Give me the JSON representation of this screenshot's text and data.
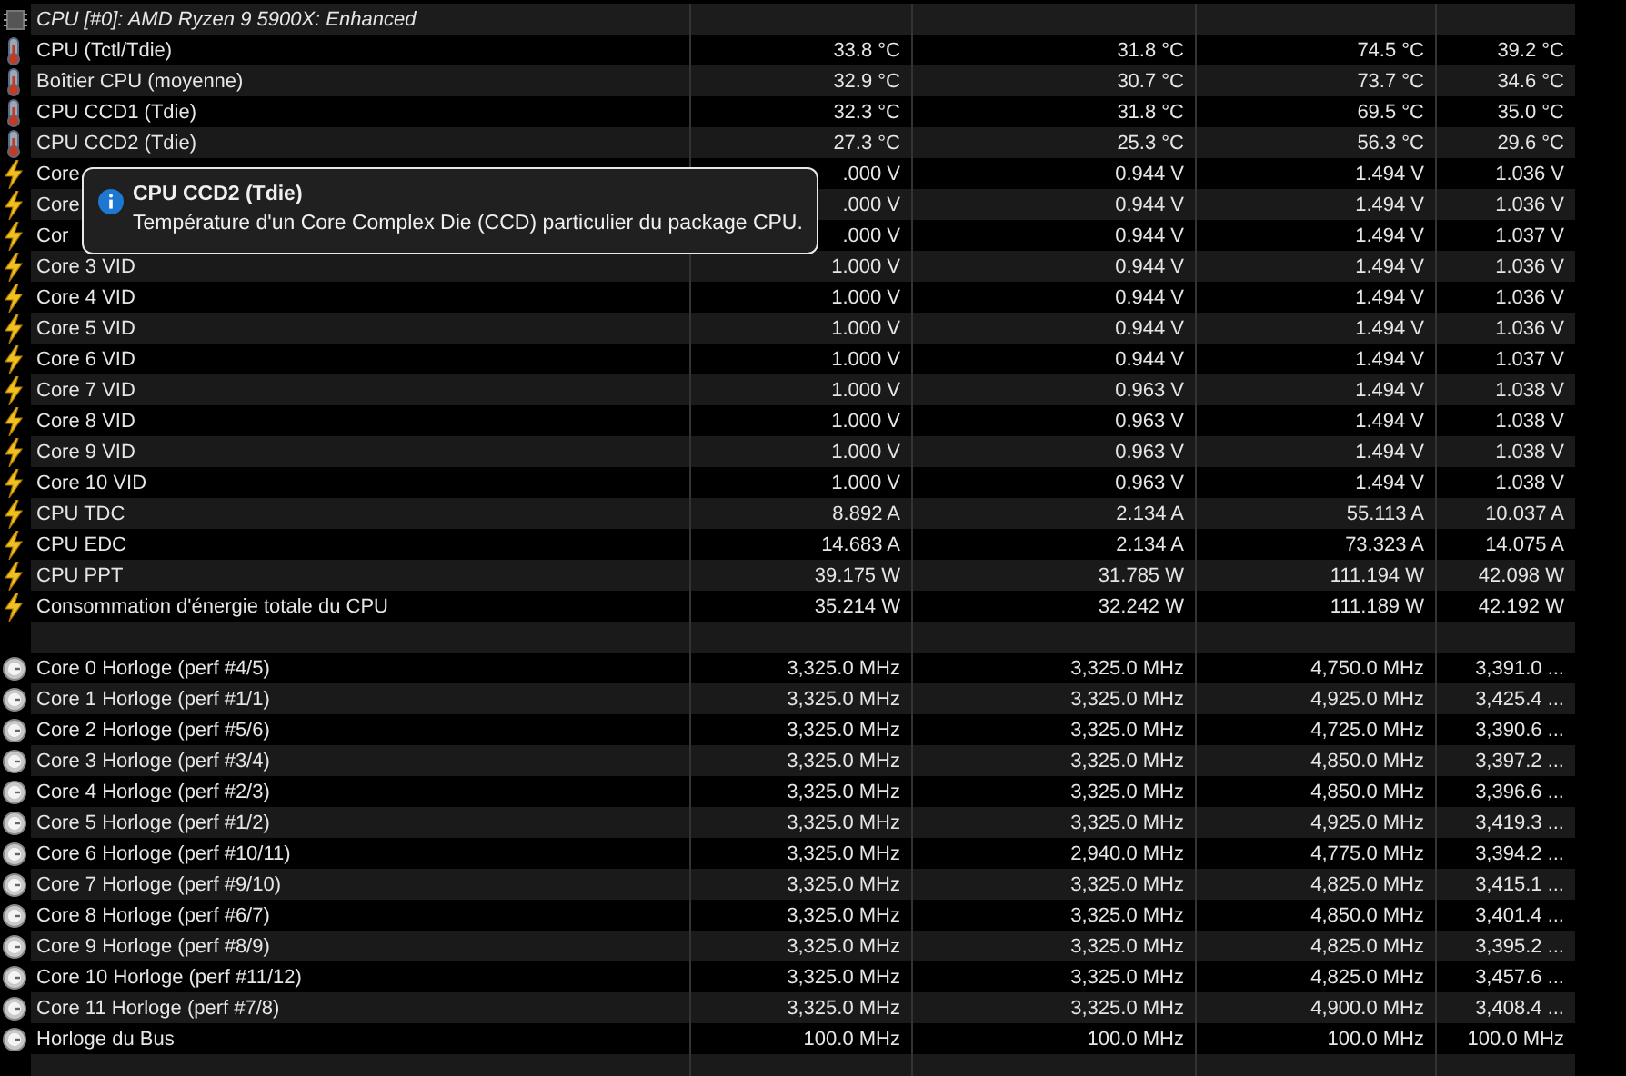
{
  "sensor_group": {
    "title": "CPU [#0]: AMD Ryzen 9 5900X: Enhanced",
    "rows": [
      {
        "kind": "temperature",
        "label": "CPU (Tctl/Tdie)",
        "values": [
          "33.8 °C",
          "31.8 °C",
          "74.5 °C",
          "39.2 °C"
        ]
      },
      {
        "kind": "temperature",
        "label": "Boîtier CPU (moyenne)",
        "values": [
          "32.9 °C",
          "30.7 °C",
          "73.7 °C",
          "34.6 °C"
        ]
      },
      {
        "kind": "temperature",
        "label": "CPU CCD1 (Tdie)",
        "values": [
          "32.3 °C",
          "31.8 °C",
          "69.5 °C",
          "35.0 °C"
        ]
      },
      {
        "kind": "temperature",
        "label": "CPU CCD2 (Tdie)",
        "values": [
          "27.3 °C",
          "25.3 °C",
          "56.3 °C",
          "29.6 °C"
        ]
      },
      {
        "kind": "voltage",
        "label": "Core",
        "values": [
          ".000 V",
          "0.944 V",
          "1.494 V",
          "1.036 V"
        ]
      },
      {
        "kind": "voltage",
        "label": "Core",
        "values": [
          ".000 V",
          "0.944 V",
          "1.494 V",
          "1.036 V"
        ]
      },
      {
        "kind": "voltage",
        "label": "Cor",
        "values": [
          ".000 V",
          "0.944 V",
          "1.494 V",
          "1.037 V"
        ]
      },
      {
        "kind": "voltage",
        "label": "Core 3 VID",
        "values": [
          "1.000 V",
          "0.944 V",
          "1.494 V",
          "1.036 V"
        ]
      },
      {
        "kind": "voltage",
        "label": "Core 4 VID",
        "values": [
          "1.000 V",
          "0.944 V",
          "1.494 V",
          "1.036 V"
        ]
      },
      {
        "kind": "voltage",
        "label": "Core 5 VID",
        "values": [
          "1.000 V",
          "0.944 V",
          "1.494 V",
          "1.036 V"
        ]
      },
      {
        "kind": "voltage",
        "label": "Core 6 VID",
        "values": [
          "1.000 V",
          "0.944 V",
          "1.494 V",
          "1.037 V"
        ]
      },
      {
        "kind": "voltage",
        "label": "Core 7 VID",
        "values": [
          "1.000 V",
          "0.963 V",
          "1.494 V",
          "1.038 V"
        ]
      },
      {
        "kind": "voltage",
        "label": "Core 8 VID",
        "values": [
          "1.000 V",
          "0.963 V",
          "1.494 V",
          "1.038 V"
        ]
      },
      {
        "kind": "voltage",
        "label": "Core 9 VID",
        "values": [
          "1.000 V",
          "0.963 V",
          "1.494 V",
          "1.038 V"
        ]
      },
      {
        "kind": "voltage",
        "label": "Core 10 VID",
        "values": [
          "1.000 V",
          "0.963 V",
          "1.494 V",
          "1.038 V"
        ]
      },
      {
        "kind": "voltage",
        "label": "CPU TDC",
        "values": [
          "8.892 A",
          "2.134 A",
          "55.113 A",
          "10.037 A"
        ]
      },
      {
        "kind": "voltage",
        "label": "CPU EDC",
        "values": [
          "14.683 A",
          "2.134 A",
          "73.323 A",
          "14.075 A"
        ]
      },
      {
        "kind": "voltage",
        "label": "CPU PPT",
        "values": [
          "39.175 W",
          "31.785 W",
          "111.194 W",
          "42.098 W"
        ]
      },
      {
        "kind": "voltage",
        "label": "Consommation d'énergie totale du CPU",
        "values": [
          "35.214 W",
          "32.242 W",
          "111.189 W",
          "42.192 W"
        ]
      },
      {
        "kind": "spacer"
      },
      {
        "kind": "clock",
        "label": "Core 0 Horloge (perf #4/5)",
        "values": [
          "3,325.0 MHz",
          "3,325.0 MHz",
          "4,750.0 MHz",
          "3,391.0 ..."
        ]
      },
      {
        "kind": "clock",
        "label": "Core 1 Horloge (perf #1/1)",
        "values": [
          "3,325.0 MHz",
          "3,325.0 MHz",
          "4,925.0 MHz",
          "3,425.4 ..."
        ]
      },
      {
        "kind": "clock",
        "label": "Core 2 Horloge (perf #5/6)",
        "values": [
          "3,325.0 MHz",
          "3,325.0 MHz",
          "4,725.0 MHz",
          "3,390.6 ..."
        ]
      },
      {
        "kind": "clock",
        "label": "Core 3 Horloge (perf #3/4)",
        "values": [
          "3,325.0 MHz",
          "3,325.0 MHz",
          "4,850.0 MHz",
          "3,397.2 ..."
        ]
      },
      {
        "kind": "clock",
        "label": "Core 4 Horloge (perf #2/3)",
        "values": [
          "3,325.0 MHz",
          "3,325.0 MHz",
          "4,850.0 MHz",
          "3,396.6 ..."
        ]
      },
      {
        "kind": "clock",
        "label": "Core 5 Horloge (perf #1/2)",
        "values": [
          "3,325.0 MHz",
          "3,325.0 MHz",
          "4,925.0 MHz",
          "3,419.3 ..."
        ]
      },
      {
        "kind": "clock",
        "label": "Core 6 Horloge (perf #10/11)",
        "values": [
          "3,325.0 MHz",
          "2,940.0 MHz",
          "4,775.0 MHz",
          "3,394.2 ..."
        ]
      },
      {
        "kind": "clock",
        "label": "Core 7 Horloge (perf #9/10)",
        "values": [
          "3,325.0 MHz",
          "3,325.0 MHz",
          "4,825.0 MHz",
          "3,415.1 ..."
        ]
      },
      {
        "kind": "clock",
        "label": "Core 8 Horloge (perf #6/7)",
        "values": [
          "3,325.0 MHz",
          "3,325.0 MHz",
          "4,850.0 MHz",
          "3,401.4 ..."
        ]
      },
      {
        "kind": "clock",
        "label": "Core 9 Horloge (perf #8/9)",
        "values": [
          "3,325.0 MHz",
          "3,325.0 MHz",
          "4,825.0 MHz",
          "3,395.2 ..."
        ]
      },
      {
        "kind": "clock",
        "label": "Core 10 Horloge (perf #11/12)",
        "values": [
          "3,325.0 MHz",
          "3,325.0 MHz",
          "4,825.0 MHz",
          "3,457.6 ..."
        ]
      },
      {
        "kind": "clock",
        "label": "Core 11 Horloge (perf #7/8)",
        "values": [
          "3,325.0 MHz",
          "3,325.0 MHz",
          "4,900.0 MHz",
          "3,408.4 ..."
        ]
      },
      {
        "kind": "clock",
        "label": "Horloge du Bus",
        "values": [
          "100.0 MHz",
          "100.0 MHz",
          "100.0 MHz",
          "100.0 MHz"
        ]
      },
      {
        "kind": "spacer"
      }
    ]
  },
  "tooltip": {
    "title": "CPU CCD2 (Tdie)",
    "text": "Température d'un Core Complex Die (CCD) particulier du package CPU."
  }
}
